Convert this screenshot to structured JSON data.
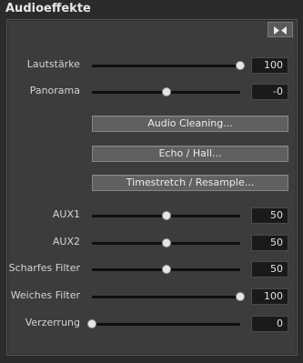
{
  "window": {
    "title": "Audioeffekte"
  },
  "sliders_top": [
    {
      "label": "Lautstärke",
      "value": "100",
      "level": 1.0
    },
    {
      "label": "Panorama",
      "value": "-0",
      "level": 0.5
    }
  ],
  "buttons": {
    "audio_cleaning": "Audio Cleaning...",
    "echo_hall": "Echo / Hall...",
    "timestretch": "Timestretch / Resample..."
  },
  "sliders_bottom": [
    {
      "label": "AUX1",
      "value": "50",
      "level": 0.5
    },
    {
      "label": "AUX2",
      "value": "50",
      "level": 0.5
    },
    {
      "label": "Scharfes Filter",
      "value": "50",
      "level": 0.5
    },
    {
      "label": "Weiches Filter",
      "value": "100",
      "level": 1.0
    },
    {
      "label": "Verzerrung",
      "value": "0",
      "level": 0.0
    }
  ],
  "icons": {
    "toggle": "collapse-arrows-icon"
  }
}
